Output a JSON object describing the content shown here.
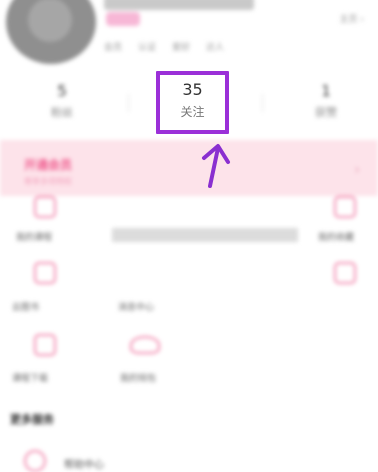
{
  "header": {
    "username": "",
    "vip_badge": "",
    "tags": [
      "会员",
      "认证",
      "爱好",
      "达人"
    ],
    "homepage_link": "主页 ›"
  },
  "stats": [
    {
      "num": "5",
      "label": "粉丝"
    },
    {
      "num": "35",
      "label": "关注"
    },
    {
      "num": "1",
      "label": "获赞"
    }
  ],
  "vip_banner": {
    "title": "开通会员",
    "subtitle": "尊享多项特权",
    "chevron": "›"
  },
  "services": [
    {
      "label": "我的课程"
    },
    {
      "label": "我的收藏"
    },
    {
      "label": "云图书"
    },
    {
      "label": "消息中心"
    },
    {
      "label": "课程下载"
    },
    {
      "label": "我的钱包"
    },
    {
      "label": "兑换码"
    }
  ],
  "more_section": {
    "title": "更多服务",
    "first_item": "帮助中心"
  },
  "colors": {
    "highlight": "#9b2fd8",
    "accent_pink": "#f06192",
    "banner_bg": "#fde3ea"
  },
  "annotation": {
    "icon": "pointer-arrow-icon"
  }
}
